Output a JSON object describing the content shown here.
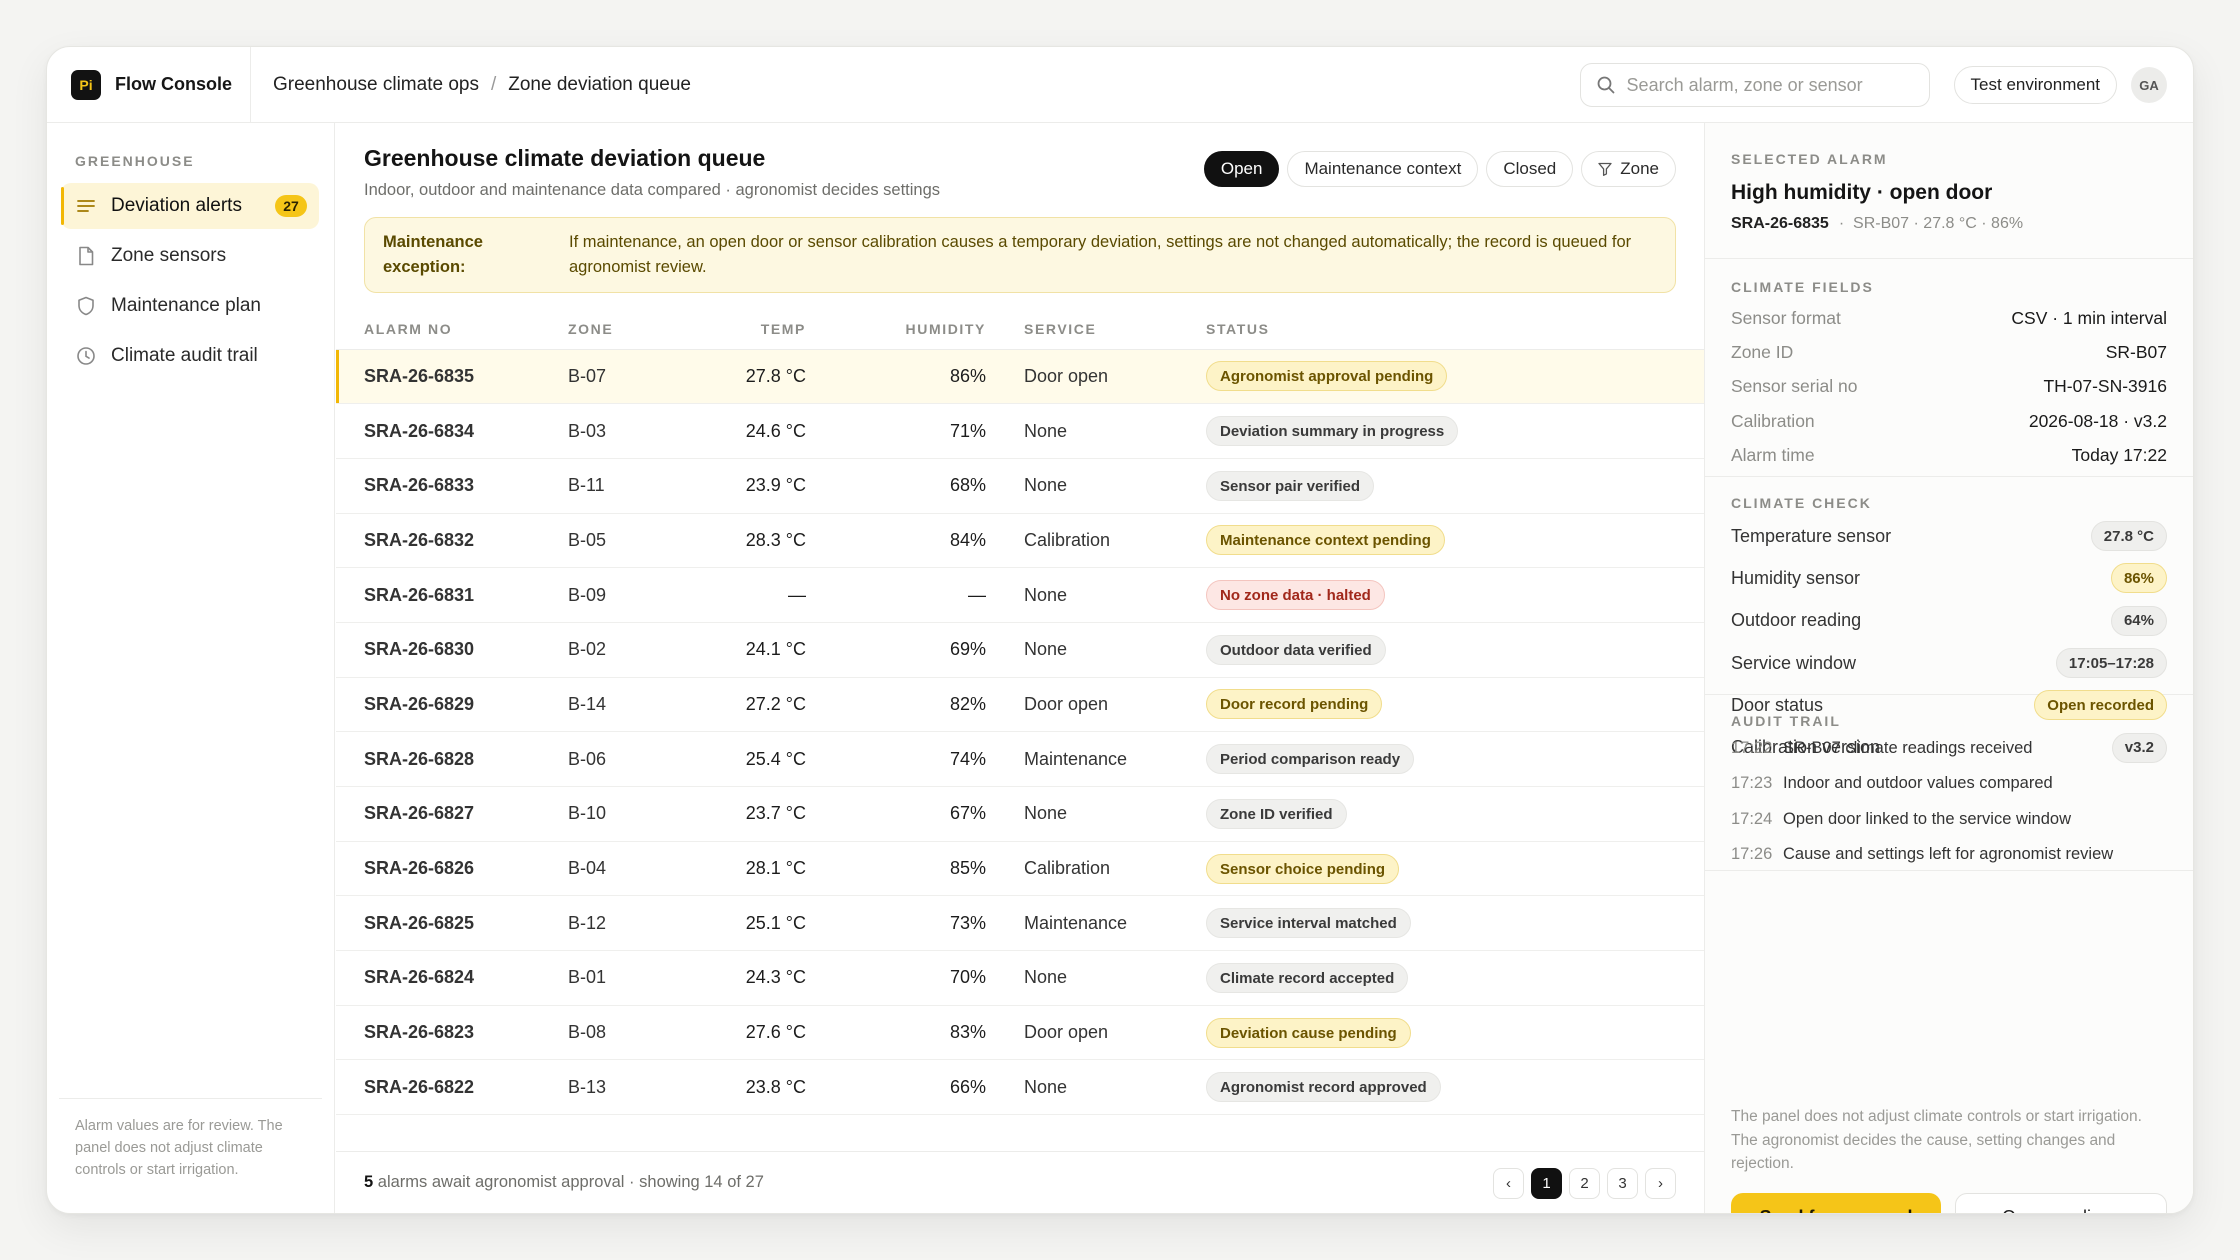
{
  "app": {
    "logo": "Pi",
    "name": "Flow Console"
  },
  "breadcrumb": {
    "root": "Greenhouse climate ops",
    "separator": "/",
    "current": "Zone deviation queue"
  },
  "search": {
    "placeholder": "Search alarm, zone or sensor",
    "value": ""
  },
  "env_label": "Test environment",
  "avatar": "GA",
  "sidebar": {
    "section": "GREENHOUSE",
    "items": [
      {
        "label": "Deviation alerts",
        "icon": "list-icon",
        "badge": "27"
      },
      {
        "label": "Zone sensors",
        "icon": "document-icon"
      },
      {
        "label": "Maintenance plan",
        "icon": "shield-icon"
      },
      {
        "label": "Climate audit trail",
        "icon": "clock-icon"
      }
    ],
    "footer": "Alarm values are for review. The panel does not adjust climate controls or start irrigation."
  },
  "main": {
    "title": "Greenhouse climate deviation queue",
    "subtitle": "Indoor, outdoor and maintenance data compared · agronomist decides settings",
    "filters": [
      "Open",
      "Maintenance context",
      "Closed",
      "Zone"
    ],
    "notice": {
      "label": "Maintenance exception:",
      "text": "If maintenance, an open door or sensor calibration causes a temporary deviation, settings are not changed automatically; the record is queued for agronomist review."
    },
    "columns": [
      "ALARM NO",
      "ZONE",
      "TEMP",
      "HUMIDITY",
      "SERVICE",
      "STATUS"
    ],
    "rows": [
      {
        "no": "SRA-26-6835",
        "zone": "B-07",
        "temp": "27.8 °C",
        "hum": "86%",
        "svc": "Door open",
        "status": "Agronomist approval pending",
        "tone": "warn"
      },
      {
        "no": "SRA-26-6834",
        "zone": "B-03",
        "temp": "24.6 °C",
        "hum": "71%",
        "svc": "None",
        "status": "Deviation summary in progress",
        "tone": "neutral"
      },
      {
        "no": "SRA-26-6833",
        "zone": "B-11",
        "temp": "23.9 °C",
        "hum": "68%",
        "svc": "None",
        "status": "Sensor pair verified",
        "tone": "neutral"
      },
      {
        "no": "SRA-26-6832",
        "zone": "B-05",
        "temp": "28.3 °C",
        "hum": "84%",
        "svc": "Calibration",
        "status": "Maintenance context pending",
        "tone": "warn"
      },
      {
        "no": "SRA-26-6831",
        "zone": "B-09",
        "temp": "—",
        "hum": "—",
        "svc": "None",
        "status": "No zone data · halted",
        "tone": "err"
      },
      {
        "no": "SRA-26-6830",
        "zone": "B-02",
        "temp": "24.1 °C",
        "hum": "69%",
        "svc": "None",
        "status": "Outdoor data verified",
        "tone": "neutral"
      },
      {
        "no": "SRA-26-6829",
        "zone": "B-14",
        "temp": "27.2 °C",
        "hum": "82%",
        "svc": "Door open",
        "status": "Door record pending",
        "tone": "warn"
      },
      {
        "no": "SRA-26-6828",
        "zone": "B-06",
        "temp": "25.4 °C",
        "hum": "74%",
        "svc": "Maintenance",
        "status": "Period comparison ready",
        "tone": "neutral"
      },
      {
        "no": "SRA-26-6827",
        "zone": "B-10",
        "temp": "23.7 °C",
        "hum": "67%",
        "svc": "None",
        "status": "Zone ID verified",
        "tone": "neutral"
      },
      {
        "no": "SRA-26-6826",
        "zone": "B-04",
        "temp": "28.1 °C",
        "hum": "85%",
        "svc": "Calibration",
        "status": "Sensor choice pending",
        "tone": "warn"
      },
      {
        "no": "SRA-26-6825",
        "zone": "B-12",
        "temp": "25.1 °C",
        "hum": "73%",
        "svc": "Maintenance",
        "status": "Service interval matched",
        "tone": "neutral"
      },
      {
        "no": "SRA-26-6824",
        "zone": "B-01",
        "temp": "24.3 °C",
        "hum": "70%",
        "svc": "None",
        "status": "Climate record accepted",
        "tone": "neutral"
      },
      {
        "no": "SRA-26-6823",
        "zone": "B-08",
        "temp": "27.6 °C",
        "hum": "83%",
        "svc": "Door open",
        "status": "Deviation cause pending",
        "tone": "warn"
      },
      {
        "no": "SRA-26-6822",
        "zone": "B-13",
        "temp": "23.8 °C",
        "hum": "66%",
        "svc": "None",
        "status": "Agronomist record approved",
        "tone": "neutral"
      }
    ],
    "footer": {
      "count": "5",
      "text": "alarms await agronomist approval · showing 14 of 27"
    },
    "pager": {
      "prev": "‹",
      "pages": [
        "1",
        "2",
        "3"
      ],
      "next": "›"
    }
  },
  "detail": {
    "label": "SELECTED ALARM",
    "title": "High humidity · open door",
    "alarm_no": "SRA-26-6835",
    "meta": "SR-B07 · 27.8 °C · 86%",
    "fields_label": "CLIMATE FIELDS",
    "fields": [
      {
        "k": "Sensor format",
        "v": "CSV · 1 min interval"
      },
      {
        "k": "Zone ID",
        "v": "SR-B07"
      },
      {
        "k": "Sensor serial no",
        "v": "TH-07-SN-3916"
      },
      {
        "k": "Calibration",
        "v": "2026-08-18 · v3.2"
      },
      {
        "k": "Alarm time",
        "v": "Today 17:22"
      }
    ],
    "check_label": "CLIMATE CHECK",
    "checks": [
      {
        "k": "Temperature sensor",
        "v": "27.8 °C",
        "tone": "neutral"
      },
      {
        "k": "Humidity sensor",
        "v": "86%",
        "tone": "warn"
      },
      {
        "k": "Outdoor reading",
        "v": "64%",
        "tone": "neutral"
      },
      {
        "k": "Service window",
        "v": "17:05–17:28",
        "tone": "neutral"
      },
      {
        "k": "Door status",
        "v": "Open recorded",
        "tone": "warn"
      },
      {
        "k": "Calibration version",
        "v": "v3.2",
        "tone": "neutral"
      }
    ],
    "audit_label": "AUDIT TRAIL",
    "audit": [
      {
        "t": "17:22",
        "text": "SR-B07 climate readings received"
      },
      {
        "t": "17:23",
        "text": "Indoor and outdoor values compared"
      },
      {
        "t": "17:24",
        "text": "Open door linked to the service window"
      },
      {
        "t": "17:26",
        "text": "Cause and settings left for agronomist review"
      }
    ],
    "note": "The panel does not adjust climate controls or start irrigation. The agronomist decides the cause, setting changes and rejection.",
    "primary": "Send for approval",
    "secondary": "Open readings"
  },
  "colors": {
    "accent": "#f5c518",
    "warn_bg": "#fdf3c7",
    "err_bg": "#fde7e4"
  }
}
